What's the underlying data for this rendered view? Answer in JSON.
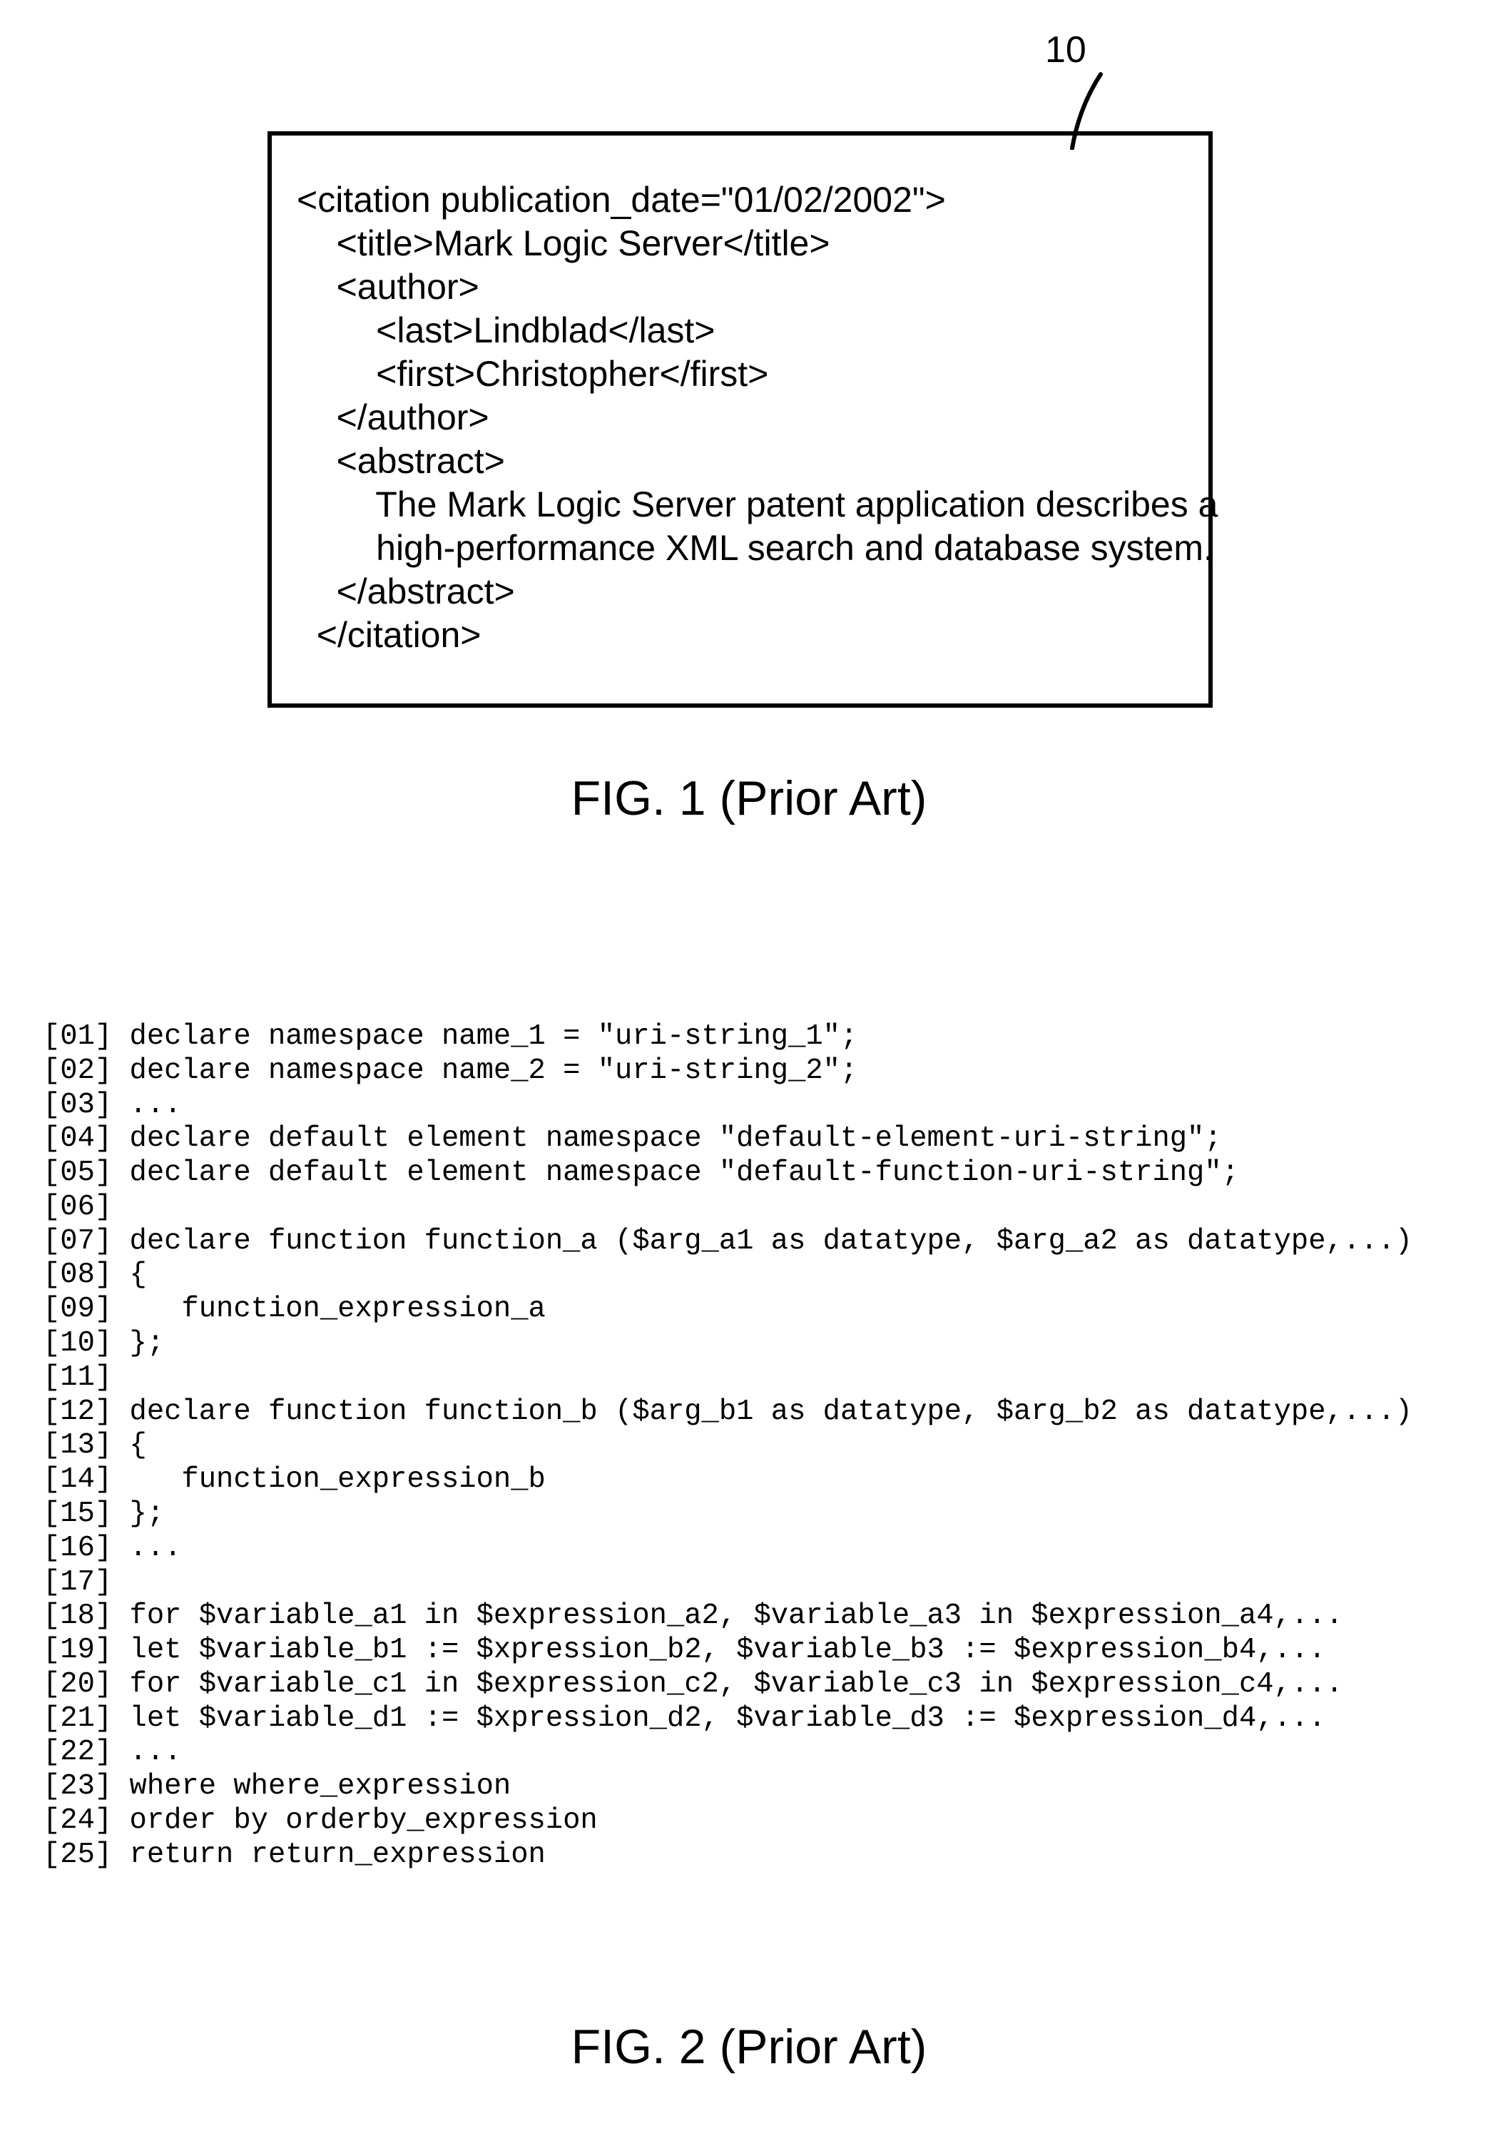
{
  "callout": {
    "label": "10"
  },
  "fig1": {
    "xml": "<citation publication_date=\"01/02/2002\">\n    <title>Mark Logic Server</title>\n    <author>\n        <last>Lindblad</last>\n        <first>Christopher</first>\n    </author>\n    <abstract>\n        The Mark Logic Server patent application describes a\n        high-performance XML search and database system.\n    </abstract>\n  </citation>",
    "caption": "FIG. 1 (Prior Art)"
  },
  "fig2": {
    "code": "[01] declare namespace name_1 = \"uri-string_1\";\n[02] declare namespace name_2 = \"uri-string_2\";\n[03] ...\n[04] declare default element namespace \"default-element-uri-string\";\n[05] declare default element namespace \"default-function-uri-string\";\n[06]\n[07] declare function function_a ($arg_a1 as datatype, $arg_a2 as datatype,...)\n[08] {\n[09]    function_expression_a\n[10] };\n[11]\n[12] declare function function_b ($arg_b1 as datatype, $arg_b2 as datatype,...)\n[13] {\n[14]    function_expression_b\n[15] };\n[16] ...\n[17]\n[18] for $variable_a1 in $expression_a2, $variable_a3 in $expression_a4,...\n[19] let $variable_b1 := $xpression_b2, $variable_b3 := $expression_b4,...\n[20] for $variable_c1 in $expression_c2, $variable_c3 in $expression_c4,...\n[21] let $variable_d1 := $xpression_d2, $variable_d3 := $expression_d4,...\n[22] ...\n[23] where where_expression\n[24] order by orderby_expression\n[25] return return_expression",
    "caption": "FIG. 2 (Prior Art)"
  }
}
